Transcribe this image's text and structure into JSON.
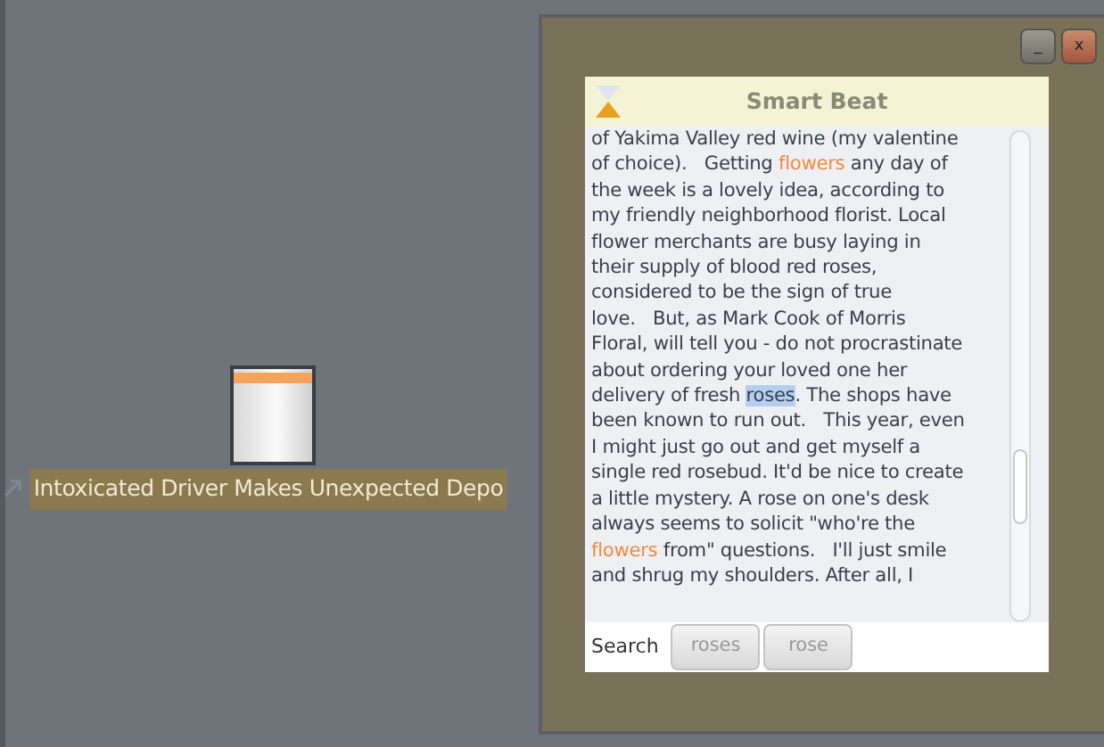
{
  "desktop_item": {
    "label": "Intoxicated Driver Makes Unexpected Depo",
    "selected": true
  },
  "window": {
    "minimize": "_",
    "close": "x",
    "title": "Smart Beat",
    "lines": [
      [
        {
          "kind": "plain",
          "text": "of Yakima Valley red wine (my valentine"
        }
      ],
      [
        {
          "kind": "plain",
          "text": "of choice).   Getting "
        },
        {
          "kind": "match",
          "text": "flowers"
        },
        {
          "kind": "plain",
          "text": " any day of"
        }
      ],
      [
        {
          "kind": "plain",
          "text": "the week is a lovely idea, according to"
        }
      ],
      [
        {
          "kind": "plain",
          "text": "my friendly neighborhood florist. Local"
        }
      ],
      [
        {
          "kind": "plain",
          "text": "flower merchants are busy laying in"
        }
      ],
      [
        {
          "kind": "plain",
          "text": "their supply of blood red roses,"
        }
      ],
      [
        {
          "kind": "plain",
          "text": "considered to be the sign of true"
        }
      ],
      [
        {
          "kind": "plain",
          "text": "love.   But, as Mark Cook of Morris"
        }
      ],
      [
        {
          "kind": "plain",
          "text": "Floral, will tell you - do not procrastinate"
        }
      ],
      [
        {
          "kind": "plain",
          "text": "about ordering your loved one her"
        }
      ],
      [
        {
          "kind": "plain",
          "text": "delivery of fresh "
        },
        {
          "kind": "selected",
          "text": "roses"
        },
        {
          "kind": "plain",
          "text": ". The shops have"
        }
      ],
      [
        {
          "kind": "plain",
          "text": "been known to run out.   This year, even"
        }
      ],
      [
        {
          "kind": "plain",
          "text": "I might just go out and get myself a"
        }
      ],
      [
        {
          "kind": "plain",
          "text": "single red rosebud. It'd be nice to create"
        }
      ],
      [
        {
          "kind": "plain",
          "text": "a little mystery. A rose on one's desk"
        }
      ],
      [
        {
          "kind": "plain",
          "text": "always seems to solicit \"who're the"
        }
      ],
      [
        {
          "kind": "match",
          "text": "flowers"
        },
        {
          "kind": "plain",
          "text": " from\" questions.   I'll just smile"
        }
      ],
      [
        {
          "kind": "plain",
          "text": "and shrug my shoulders. After all, I"
        }
      ]
    ],
    "search_label": "Search",
    "search_terms": [
      "roses",
      "rose"
    ]
  }
}
